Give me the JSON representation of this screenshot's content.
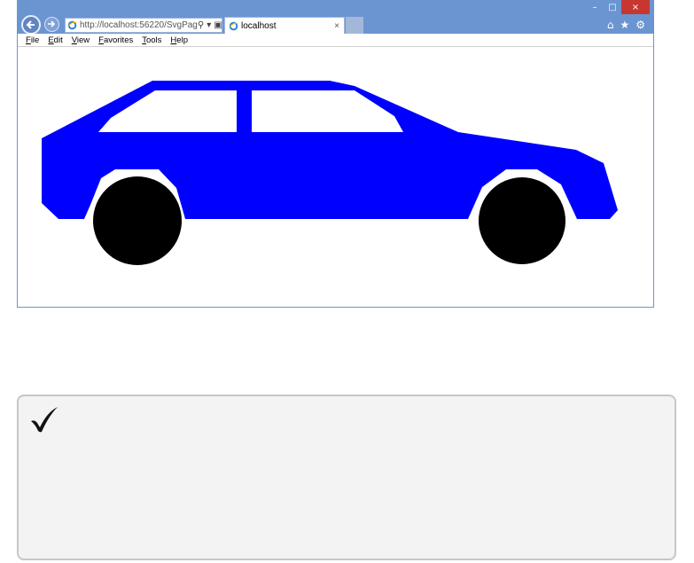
{
  "browser": {
    "address_url": "http://localhost:56220/SvgPag",
    "tab_title": "localhost",
    "tab_close": "×",
    "menu": [
      "File",
      "Edit",
      "View",
      "Favorites",
      "Tools",
      "Help"
    ],
    "window_controls": {
      "minimize": "–",
      "maximize": "□",
      "close": "×"
    },
    "toolbar_icons": [
      "home-icon",
      "favorites-star-icon",
      "settings-gear-icon"
    ]
  },
  "content": {
    "image": "blue-car-svg",
    "colors": {
      "car_body": "#0000ff",
      "wheels": "#000000",
      "windows": "#ffffff"
    }
  },
  "note": {
    "icon": "checkmark-icon",
    "text": ""
  }
}
